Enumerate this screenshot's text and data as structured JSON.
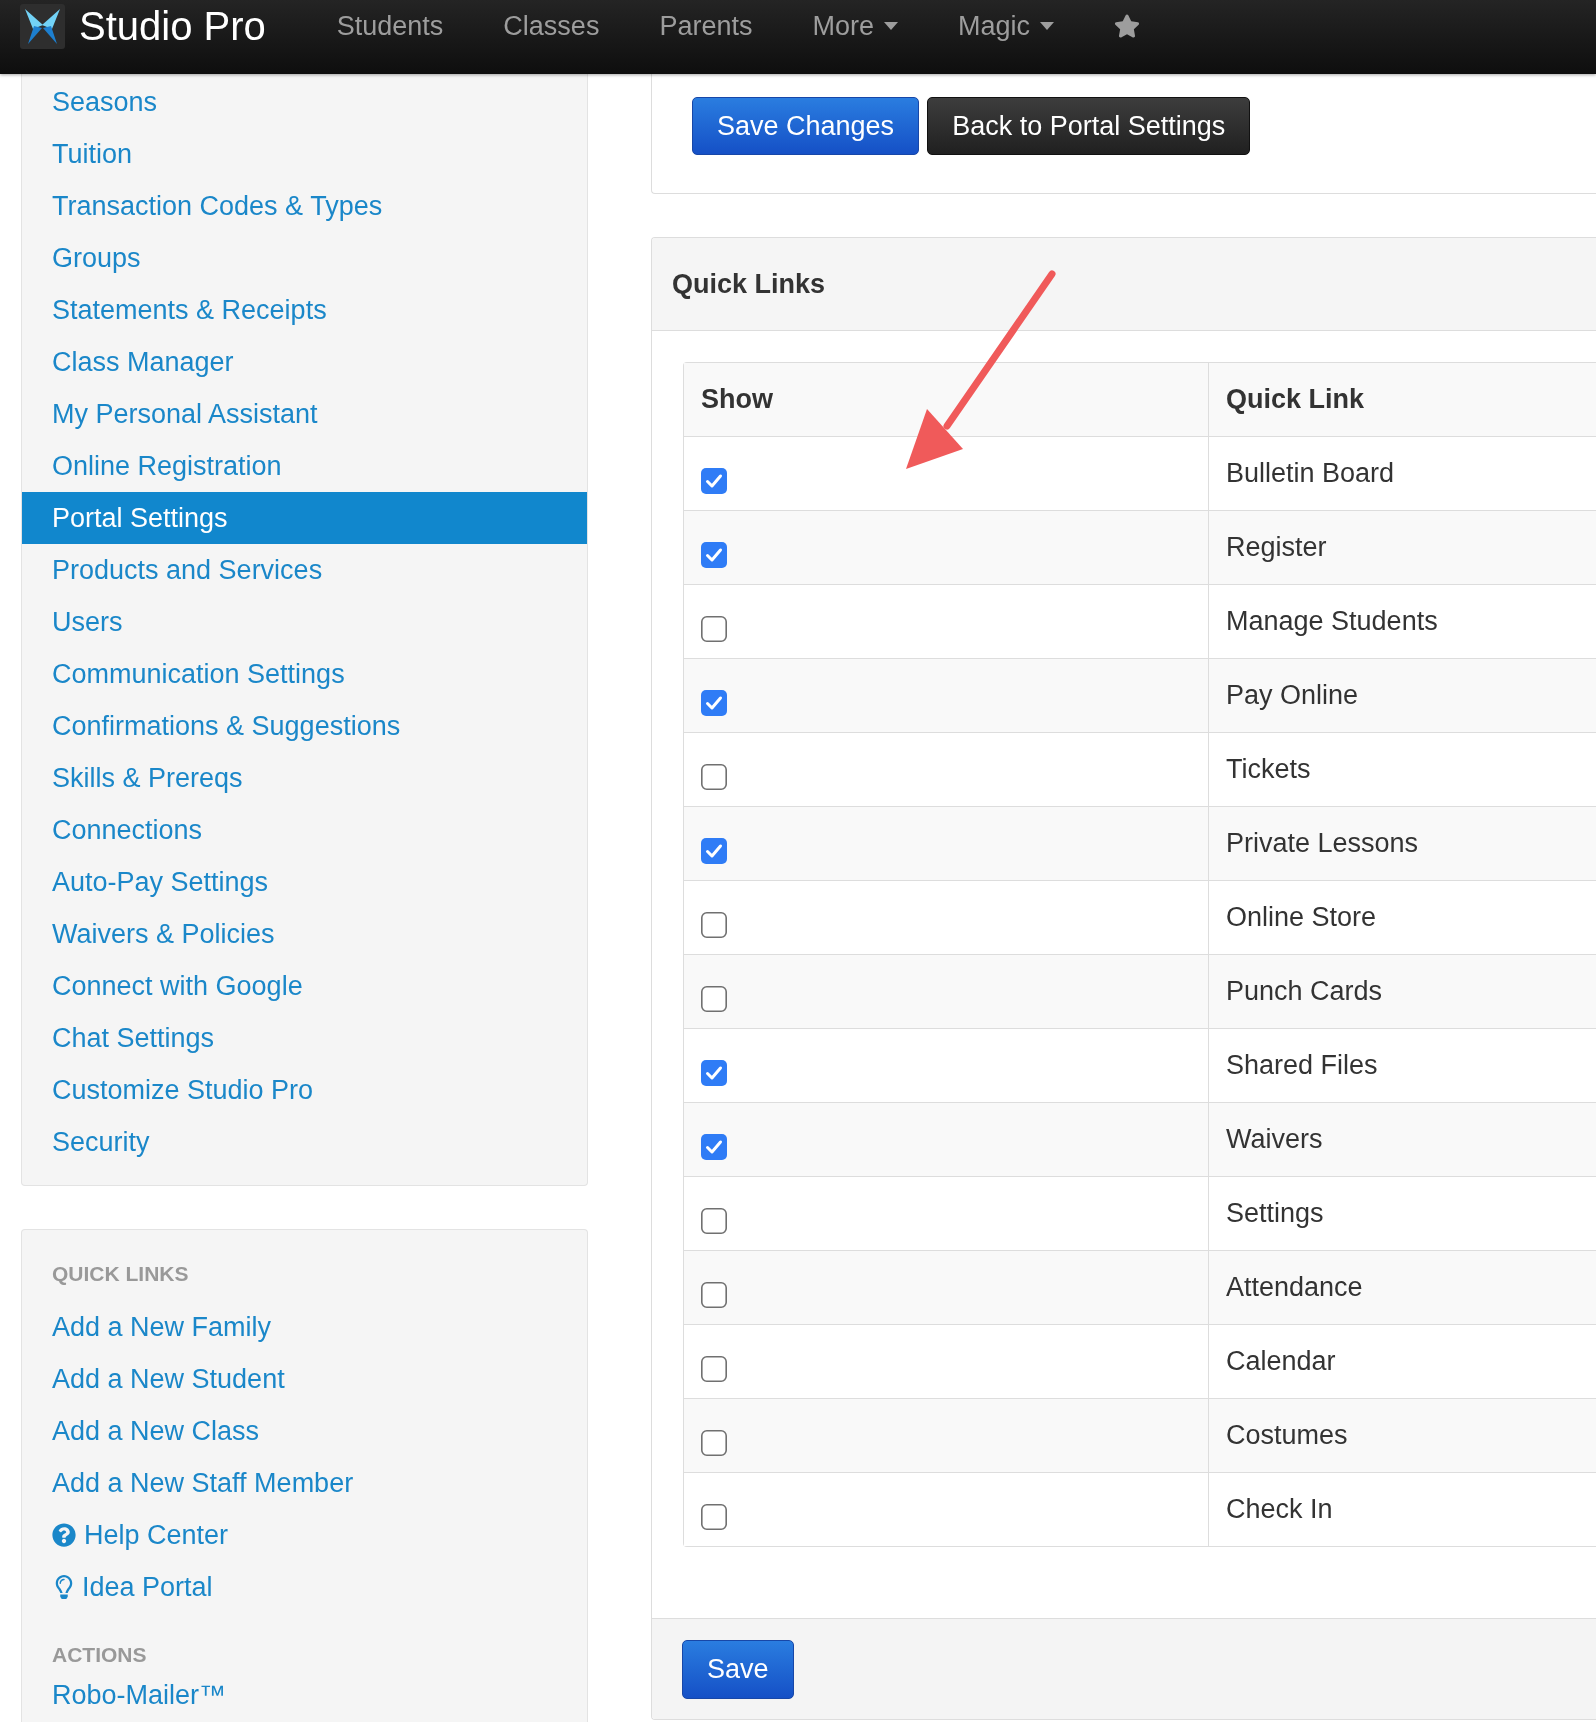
{
  "navbar": {
    "brand": "Studio Pro",
    "items": [
      {
        "kind": "link",
        "label": "Students"
      },
      {
        "kind": "link",
        "label": "Classes"
      },
      {
        "kind": "link",
        "label": "Parents"
      },
      {
        "kind": "dropdown",
        "label": "More"
      },
      {
        "kind": "dropdown",
        "label": "Magic"
      },
      {
        "kind": "star"
      }
    ]
  },
  "sidebar": {
    "menu": [
      {
        "label": "Seasons",
        "selected": false
      },
      {
        "label": "Tuition",
        "selected": false
      },
      {
        "label": "Transaction Codes & Types",
        "selected": false
      },
      {
        "label": "Groups",
        "selected": false
      },
      {
        "label": "Statements & Receipts",
        "selected": false
      },
      {
        "label": "Class Manager",
        "selected": false
      },
      {
        "label": "My Personal Assistant",
        "selected": false
      },
      {
        "label": "Online Registration",
        "selected": false
      },
      {
        "label": "Portal Settings",
        "selected": true
      },
      {
        "label": "Products and Services",
        "selected": false
      },
      {
        "label": "Users",
        "selected": false
      },
      {
        "label": "Communication Settings",
        "selected": false
      },
      {
        "label": "Confirmations & Suggestions",
        "selected": false
      },
      {
        "label": "Skills & Prereqs",
        "selected": false
      },
      {
        "label": "Connections",
        "selected": false
      },
      {
        "label": "Auto-Pay Settings",
        "selected": false
      },
      {
        "label": "Waivers & Policies",
        "selected": false
      },
      {
        "label": "Connect with Google",
        "selected": false
      },
      {
        "label": "Chat Settings",
        "selected": false
      },
      {
        "label": "Customize Studio Pro",
        "selected": false
      },
      {
        "label": "Security",
        "selected": false
      }
    ],
    "sections": [
      {
        "heading": "QUICK LINKS",
        "links": [
          {
            "kind": "plain",
            "label": "Add a New Family"
          },
          {
            "kind": "plain",
            "label": "Add a New Student"
          },
          {
            "kind": "plain",
            "label": "Add a New Class"
          },
          {
            "kind": "plain",
            "label": "Add a New Staff Member"
          },
          {
            "kind": "help",
            "label": "Help Center"
          },
          {
            "kind": "idea",
            "label": "Idea Portal"
          }
        ]
      },
      {
        "heading": "ACTIONS",
        "links": [
          {
            "kind": "plain",
            "label": "Robo-Mailer™"
          }
        ]
      }
    ]
  },
  "toolbar": {
    "buttons": [
      {
        "kind": "primary",
        "label": "Save Changes"
      },
      {
        "kind": "dark",
        "label": "Back to Portal Settings"
      }
    ]
  },
  "quick_links_panel": {
    "title": "Quick Links",
    "table": {
      "columns": [
        "Show",
        "Quick Link"
      ],
      "rows": [
        {
          "checked": true,
          "label": "Bulletin Board"
        },
        {
          "checked": true,
          "label": "Register"
        },
        {
          "checked": false,
          "label": "Manage Students"
        },
        {
          "checked": true,
          "label": "Pay Online"
        },
        {
          "checked": false,
          "label": "Tickets"
        },
        {
          "checked": true,
          "label": "Private Lessons"
        },
        {
          "checked": false,
          "label": "Online Store"
        },
        {
          "checked": false,
          "label": "Punch Cards"
        },
        {
          "checked": true,
          "label": "Shared Files"
        },
        {
          "checked": true,
          "label": "Waivers"
        },
        {
          "checked": false,
          "label": "Settings"
        },
        {
          "checked": false,
          "label": "Attendance"
        },
        {
          "checked": false,
          "label": "Calendar"
        },
        {
          "checked": false,
          "label": "Costumes"
        },
        {
          "checked": false,
          "label": "Check In"
        }
      ]
    },
    "footer_button": {
      "kind": "primary",
      "label": "Save"
    }
  }
}
